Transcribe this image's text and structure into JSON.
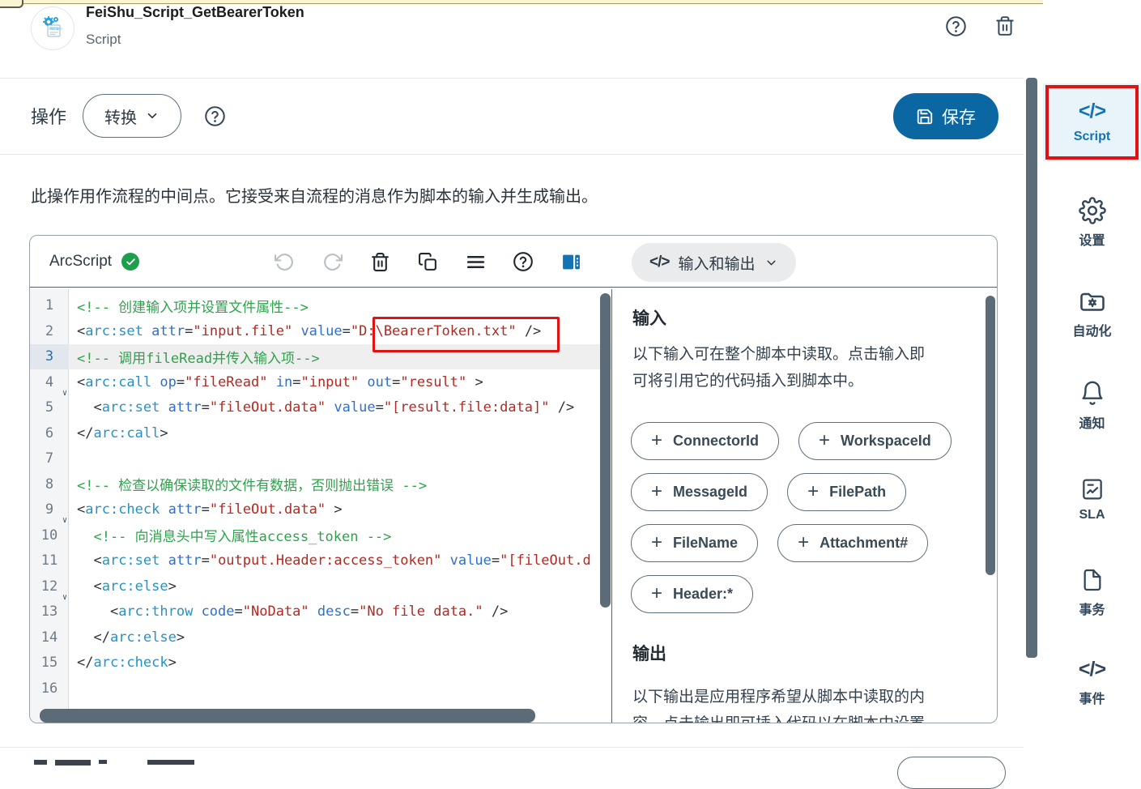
{
  "colors": {
    "accent_blue": "#0b67a2",
    "active_blue": "#1273b5",
    "annotation_red": "#e31212",
    "scrollbar": "#5c6b78",
    "comment_green": "#2fa24c",
    "string_red": "#b22a22",
    "tag_blue": "#2792c3",
    "attr_blue": "#2e6fd0"
  },
  "window": {
    "title": "FeiShu_Script_GetBearerToken",
    "subtitle": "Script"
  },
  "action_bar": {
    "label": "操作",
    "action_type": "转换",
    "save": "保存"
  },
  "description": "此操作用作流程的中间点。它接受来自流程的消息作为脚本的输入并生成输出。",
  "editor": {
    "language": "ArcScript",
    "code_lines": [
      {
        "n": 1,
        "tokens": [
          [
            "c",
            "<!-- 创建输入项并设置文件属性-->"
          ]
        ]
      },
      {
        "n": 2,
        "tokens": [
          [
            "p",
            "<"
          ],
          [
            "tag",
            "arc:set"
          ],
          [
            "p",
            " "
          ],
          [
            "attr",
            "attr"
          ],
          [
            "p",
            "="
          ],
          [
            "str",
            "\"input.file\""
          ],
          [
            "p",
            " "
          ],
          [
            "attr",
            "value"
          ],
          [
            "p",
            "="
          ],
          [
            "str",
            "\"D:\\BearerToken.txt\""
          ],
          [
            "p",
            " />"
          ]
        ]
      },
      {
        "n": 3,
        "active": true,
        "tokens": [
          [
            "c",
            "<!-- 调用fileRead并传入输入项-->"
          ]
        ]
      },
      {
        "n": 4,
        "fold": true,
        "tokens": [
          [
            "p",
            "<"
          ],
          [
            "tag",
            "arc:call"
          ],
          [
            "p",
            " "
          ],
          [
            "attr",
            "op"
          ],
          [
            "p",
            "="
          ],
          [
            "str",
            "\"fileRead\""
          ],
          [
            "p",
            " "
          ],
          [
            "attr",
            "in"
          ],
          [
            "p",
            "="
          ],
          [
            "str",
            "\"input\""
          ],
          [
            "p",
            " "
          ],
          [
            "attr",
            "out"
          ],
          [
            "p",
            "="
          ],
          [
            "str",
            "\"result\""
          ],
          [
            "p",
            " >"
          ]
        ]
      },
      {
        "n": 5,
        "tokens": [
          [
            "p",
            "  <"
          ],
          [
            "tag",
            "arc:set"
          ],
          [
            "p",
            " "
          ],
          [
            "attr",
            "attr"
          ],
          [
            "p",
            "="
          ],
          [
            "str",
            "\"fileOut.data\""
          ],
          [
            "p",
            " "
          ],
          [
            "attr",
            "value"
          ],
          [
            "p",
            "="
          ],
          [
            "str",
            "\"[result.file:data]\""
          ],
          [
            "p",
            " />"
          ]
        ]
      },
      {
        "n": 6,
        "tokens": [
          [
            "p",
            "</"
          ],
          [
            "tag",
            "arc:call"
          ],
          [
            "p",
            ">"
          ]
        ]
      },
      {
        "n": 7,
        "tokens": []
      },
      {
        "n": 8,
        "tokens": [
          [
            "c",
            "<!-- 检查以确保读取的文件有数据，否则抛出错误 -->"
          ]
        ]
      },
      {
        "n": 9,
        "fold": true,
        "tokens": [
          [
            "p",
            "<"
          ],
          [
            "tag",
            "arc:check"
          ],
          [
            "p",
            " "
          ],
          [
            "attr",
            "attr"
          ],
          [
            "p",
            "="
          ],
          [
            "str",
            "\"fileOut.data\""
          ],
          [
            "p",
            " >"
          ]
        ]
      },
      {
        "n": 10,
        "tokens": [
          [
            "c",
            "  <!-- 向消息头中写入属性access_token -->"
          ]
        ]
      },
      {
        "n": 11,
        "tokens": [
          [
            "p",
            "  <"
          ],
          [
            "tag",
            "arc:set"
          ],
          [
            "p",
            " "
          ],
          [
            "attr",
            "attr"
          ],
          [
            "p",
            "="
          ],
          [
            "str",
            "\"output.Header:access_token\""
          ],
          [
            "p",
            " "
          ],
          [
            "attr",
            "value"
          ],
          [
            "p",
            "="
          ],
          [
            "str",
            "\"[fileOut.d"
          ]
        ]
      },
      {
        "n": 12,
        "fold": true,
        "tokens": [
          [
            "p",
            "  <"
          ],
          [
            "tag",
            "arc:else"
          ],
          [
            "p",
            ">"
          ]
        ]
      },
      {
        "n": 13,
        "tokens": [
          [
            "p",
            "    <"
          ],
          [
            "tag",
            "arc:throw"
          ],
          [
            "p",
            " "
          ],
          [
            "attr",
            "code"
          ],
          [
            "p",
            "="
          ],
          [
            "str",
            "\"NoData\""
          ],
          [
            "p",
            " "
          ],
          [
            "attr",
            "desc"
          ],
          [
            "p",
            "="
          ],
          [
            "str",
            "\"No file data.\""
          ],
          [
            "p",
            " />"
          ]
        ]
      },
      {
        "n": 14,
        "tokens": [
          [
            "p",
            "  </"
          ],
          [
            "tag",
            "arc:else"
          ],
          [
            "p",
            ">"
          ]
        ]
      },
      {
        "n": 15,
        "tokens": [
          [
            "p",
            "</"
          ],
          [
            "tag",
            "arc:check"
          ],
          [
            "p",
            ">"
          ]
        ]
      },
      {
        "n": 16,
        "tokens": []
      }
    ]
  },
  "io_panel": {
    "header": "输入和输出",
    "input_heading": "输入",
    "input_desc_lines": [
      "以下输入可在整个脚本中读取。点击输入即",
      "可将引用它的代码插入到脚本中。"
    ],
    "input_chips": [
      "ConnectorId",
      "WorkspaceId",
      "MessageId",
      "FilePath",
      "FileName",
      "Attachment#",
      "Header:*"
    ],
    "output_heading": "输出",
    "output_desc_lines": [
      "以下输出是应用程序希望从脚本中读取的内",
      "容，点击输出即可插入代码以在脚本中设置"
    ]
  },
  "sidebar": {
    "items": [
      {
        "label": "Script",
        "icon": "code",
        "active": true
      },
      {
        "label": "设置",
        "icon": "gear"
      },
      {
        "label": "自动化",
        "icon": "folder-gear"
      },
      {
        "label": "通知",
        "icon": "bell"
      },
      {
        "label": "SLA",
        "icon": "doc-chart"
      },
      {
        "label": "事务",
        "icon": "doc"
      },
      {
        "label": "事件",
        "icon": "code"
      }
    ]
  }
}
